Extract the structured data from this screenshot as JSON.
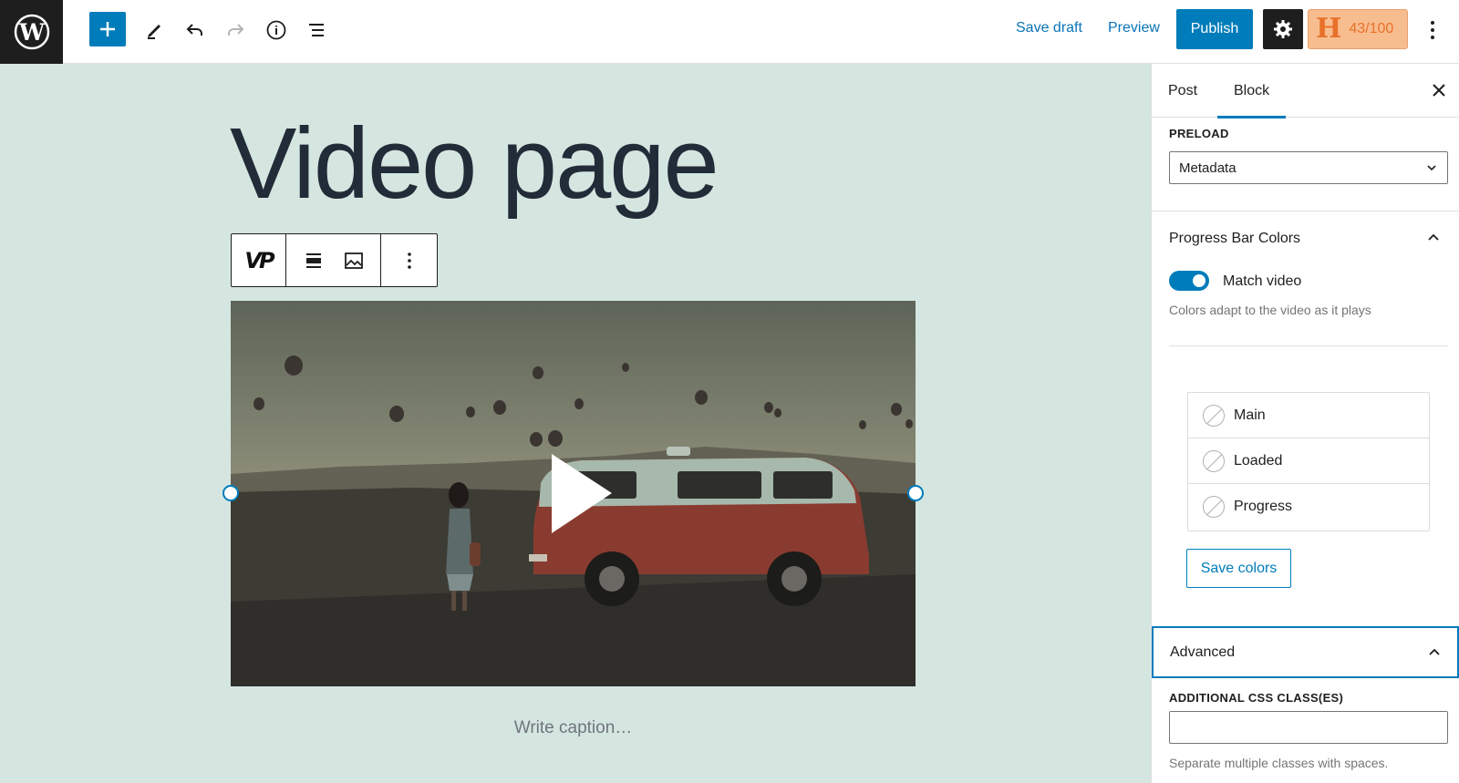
{
  "topbar": {
    "save_draft": "Save draft",
    "preview": "Preview",
    "publish": "Publish",
    "score_letter": "H",
    "score": "43/100"
  },
  "icons": {
    "logo": "wordpress-logo-icon",
    "add": "plus-icon",
    "edit": "pencil-icon",
    "undo": "undo-icon",
    "redo": "redo-icon",
    "info": "info-icon",
    "outline": "list-view-icon",
    "settings": "gear-icon",
    "more": "vertical-ellipsis-icon"
  },
  "editor": {
    "title": "Video page",
    "block_toolbar": {
      "brand": "VP"
    },
    "caption_placeholder": "Write caption…"
  },
  "sidebar": {
    "tabs": [
      "Post",
      "Block"
    ],
    "active_tab": "Block",
    "preload_label": "PRELOAD",
    "preload_value": "Metadata",
    "progress_panel": {
      "title": "Progress Bar Colors",
      "toggle_label": "Match video",
      "toggle_on": true,
      "help": "Colors adapt to the video as it plays",
      "colors": [
        "Main",
        "Loaded",
        "Progress"
      ],
      "save_button": "Save colors"
    },
    "advanced": {
      "title": "Advanced",
      "css_label": "ADDITIONAL CSS CLASS(ES)",
      "css_value": "",
      "css_help": "Separate multiple classes with spaces."
    }
  },
  "colors": {
    "accent": "#007cba",
    "canvas_bg": "#d5e6e1",
    "score_bg": "#f8bd8f",
    "score_text": "#e8712a"
  }
}
